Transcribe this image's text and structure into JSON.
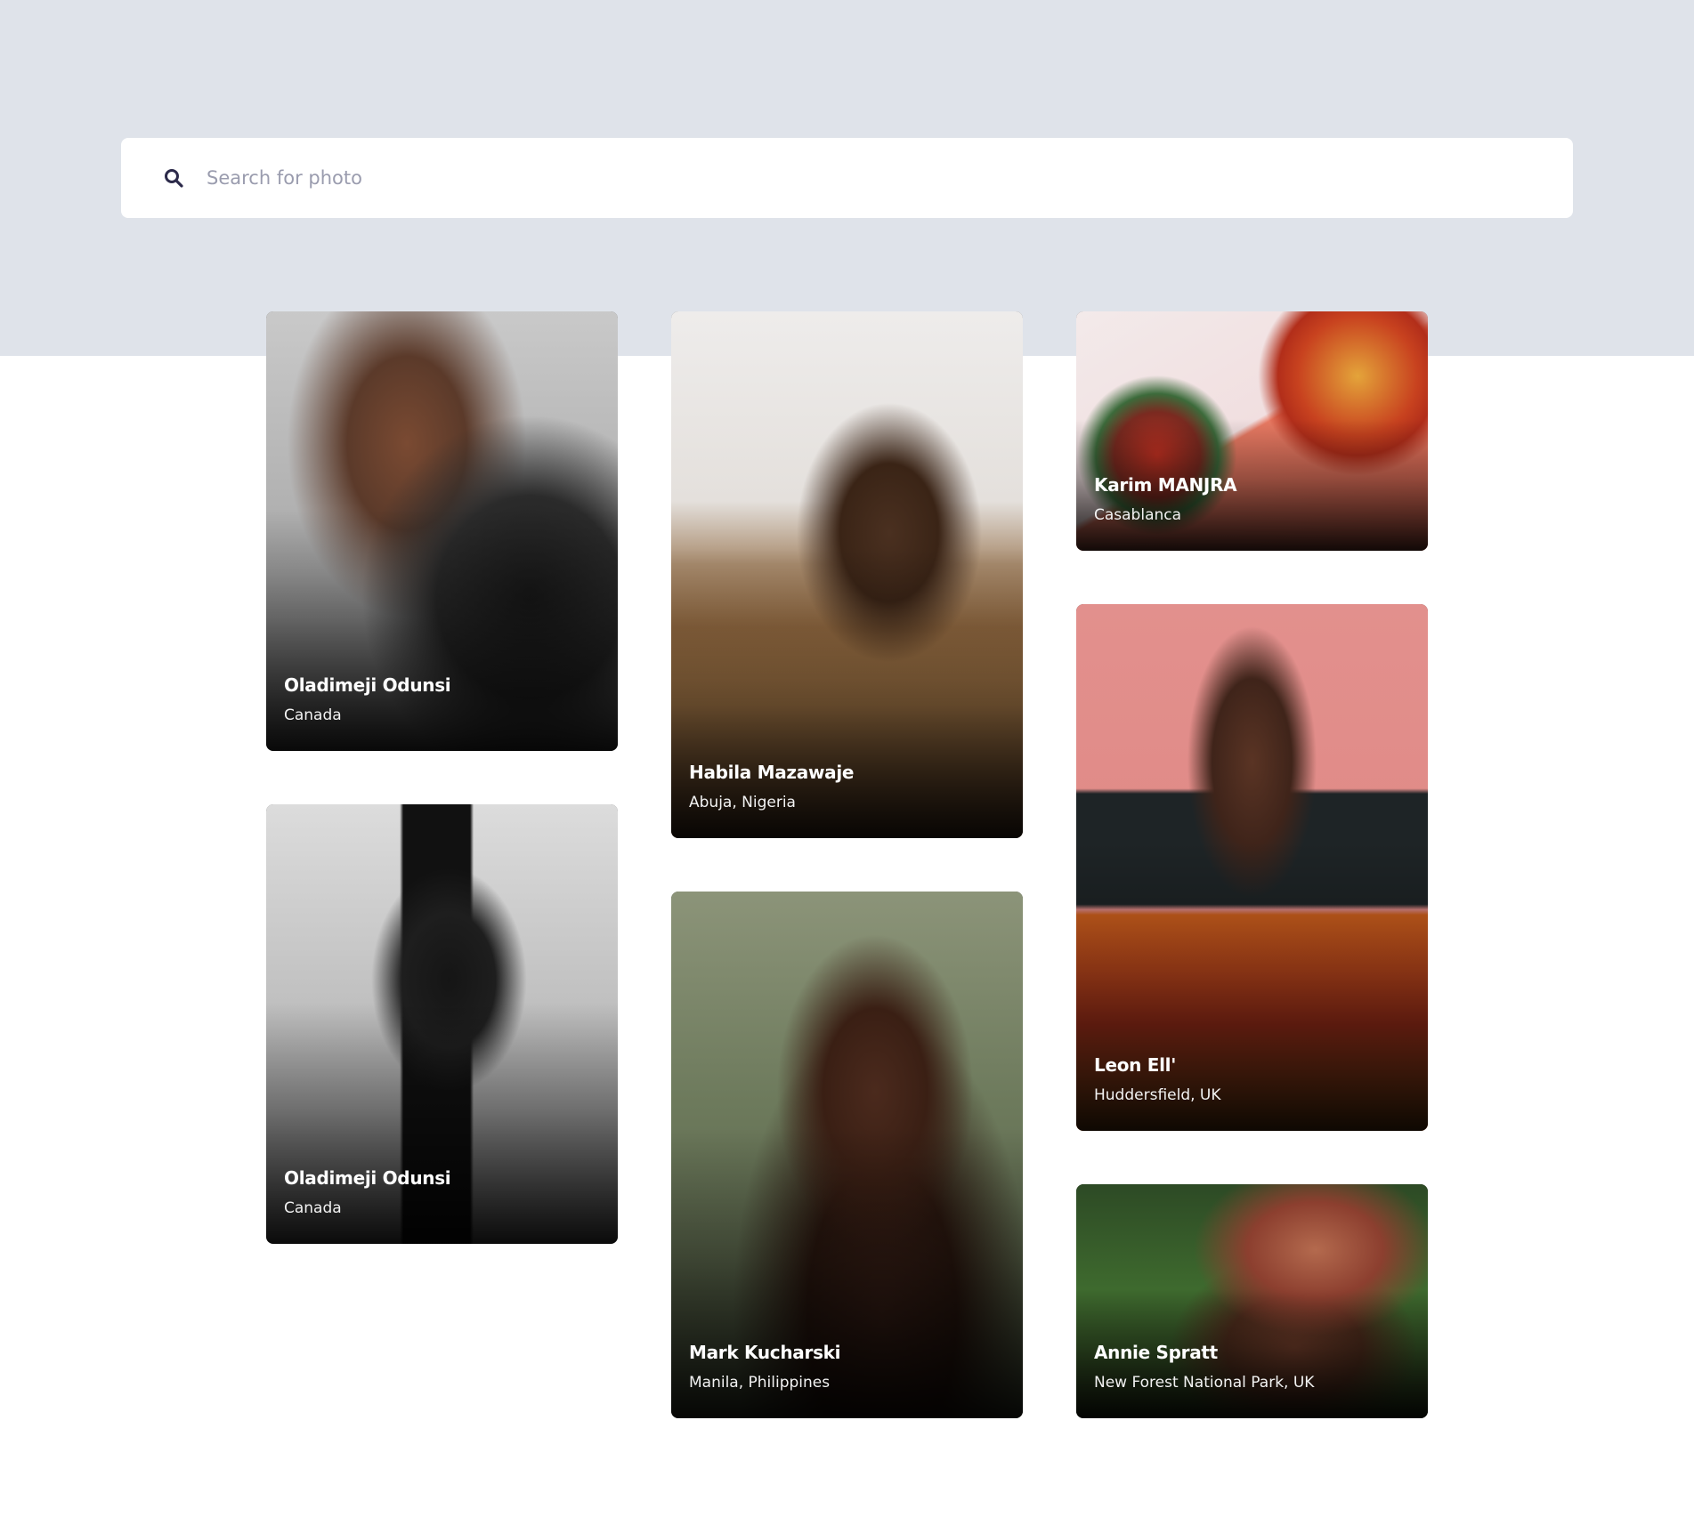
{
  "search": {
    "placeholder": "Search for photo",
    "icon": "search-icon"
  },
  "colors": {
    "hero_band": "#dfe3ea",
    "search_icon": "#2c2a4a",
    "placeholder": "#9a9cae"
  },
  "cards": [
    {
      "name": "Oladimeji Odunsi",
      "location": "Canada"
    },
    {
      "name": "Oladimeji Odunsi",
      "location": "Canada"
    },
    {
      "name": "Habila Mazawaje",
      "location": "Abuja, Nigeria"
    },
    {
      "name": "Mark Kucharski",
      "location": "Manila, Philippines"
    },
    {
      "name": "Karim MANJRA",
      "location": "Casablanca"
    },
    {
      "name": "Leon Ell'",
      "location": "Huddersfield, UK"
    },
    {
      "name": "Annie Spratt",
      "location": "New Forest National Park, UK"
    }
  ]
}
